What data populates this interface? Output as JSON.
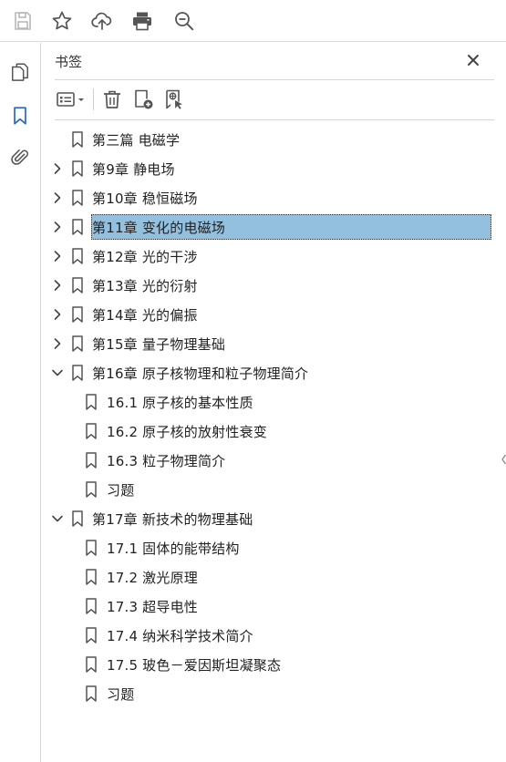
{
  "toolbar": {
    "buttons": [
      {
        "icon": "save-icon",
        "enabled": false
      },
      {
        "icon": "star-icon",
        "enabled": true
      },
      {
        "icon": "upload-cloud-icon",
        "enabled": true
      },
      {
        "icon": "print-icon",
        "enabled": true
      },
      {
        "icon": "zoom-out-icon",
        "enabled": true
      }
    ]
  },
  "left_rail": {
    "items": [
      {
        "icon": "pages-icon",
        "active": false
      },
      {
        "icon": "bookmark-icon",
        "active": true
      },
      {
        "icon": "attachment-icon",
        "active": false
      }
    ]
  },
  "panel": {
    "title": "书签",
    "tools": [
      "options-menu-icon",
      "trash-icon",
      "new-bookmark-icon",
      "bookmark-search-icon"
    ]
  },
  "bookmarks": [
    {
      "level": 0,
      "expander": "none",
      "label": "第三篇  电磁学",
      "selected": false
    },
    {
      "level": 0,
      "expander": "collapsed",
      "label": "第9章  静电场",
      "selected": false
    },
    {
      "level": 0,
      "expander": "collapsed",
      "label": "第10章  稳恒磁场",
      "selected": false
    },
    {
      "level": 0,
      "expander": "collapsed",
      "label": "第11章  变化的电磁场",
      "selected": true
    },
    {
      "level": 0,
      "expander": "collapsed",
      "label": "第12章  光的干涉",
      "selected": false
    },
    {
      "level": 0,
      "expander": "collapsed",
      "label": "第13章  光的衍射",
      "selected": false
    },
    {
      "level": 0,
      "expander": "collapsed",
      "label": "第14章  光的偏振",
      "selected": false
    },
    {
      "level": 0,
      "expander": "collapsed",
      "label": "第15章  量子物理基础",
      "selected": false
    },
    {
      "level": 0,
      "expander": "expanded",
      "label": "第16章  原子核物理和粒子物理简介",
      "selected": false
    },
    {
      "level": 1,
      "expander": "none",
      "label": "16.1  原子核的基本性质",
      "selected": false
    },
    {
      "level": 1,
      "expander": "none",
      "label": "16.2  原子核的放射性衰变",
      "selected": false
    },
    {
      "level": 1,
      "expander": "none",
      "label": "16.3  粒子物理简介",
      "selected": false
    },
    {
      "level": 1,
      "expander": "none",
      "label": "习题",
      "selected": false
    },
    {
      "level": 0,
      "expander": "expanded",
      "label": "第17章  新技术的物理基础",
      "selected": false
    },
    {
      "level": 1,
      "expander": "none",
      "label": "17.1  固体的能带结构",
      "selected": false
    },
    {
      "level": 1,
      "expander": "none",
      "label": "17.2  激光原理",
      "selected": false
    },
    {
      "level": 1,
      "expander": "none",
      "label": "17.3  超导电性",
      "selected": false
    },
    {
      "level": 1,
      "expander": "none",
      "label": "17.4  纳米科学技术简介",
      "selected": false
    },
    {
      "level": 1,
      "expander": "none",
      "label": "17.5  玻色－爱因斯坦凝聚态",
      "selected": false
    },
    {
      "level": 1,
      "expander": "none",
      "label": "习题",
      "selected": false
    }
  ],
  "colors": {
    "icon": "#555555",
    "icon_disabled": "#b8b8b8",
    "accent": "#2d6dbd",
    "selection": "#93c0de"
  }
}
